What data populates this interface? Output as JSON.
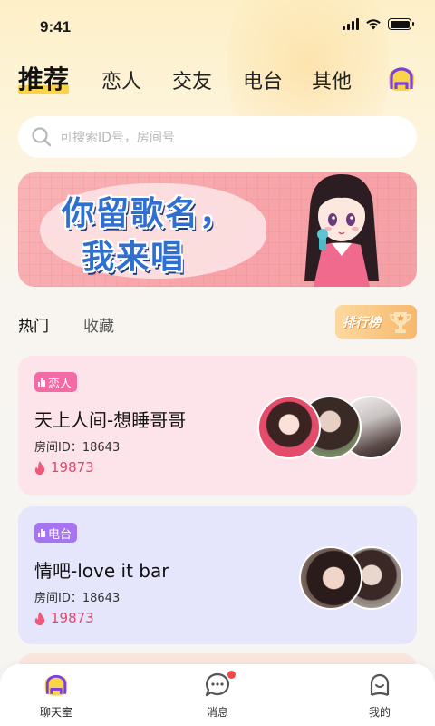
{
  "status_bar": {
    "time": "9:41"
  },
  "top_tabs": [
    {
      "label": "推荐",
      "active": true
    },
    {
      "label": "恋人"
    },
    {
      "label": "交友"
    },
    {
      "label": "电台"
    },
    {
      "label": "其他"
    }
  ],
  "search": {
    "placeholder": "可搜索ID号，房间号"
  },
  "banner": {
    "line1": "你留歌名，",
    "line2": "我来唱"
  },
  "section": {
    "tab_hot": "热门",
    "tab_fav": "收藏",
    "rank_label": "排行榜"
  },
  "rooms": [
    {
      "tag": "恋人",
      "title": "天上人间-想睡哥哥",
      "id_label": "房间ID：",
      "id": "18643",
      "heat": "19873"
    },
    {
      "tag": "电台",
      "title": "情吧-love it bar",
      "id_label": "房间ID：",
      "id": "18643",
      "heat": "19873"
    }
  ],
  "bottom_nav": [
    {
      "label": "聊天室",
      "icon": "chat-room-icon",
      "active": true
    },
    {
      "label": "消息",
      "icon": "message-icon",
      "badge": true
    },
    {
      "label": "我的",
      "icon": "profile-icon"
    }
  ],
  "colors": {
    "accent_yellow": "#f9d34a",
    "tag_pink": "#f36aa5",
    "tag_purple": "#a674f0",
    "heat_red": "#e8446a",
    "nav_purple": "#7b3fe4"
  }
}
